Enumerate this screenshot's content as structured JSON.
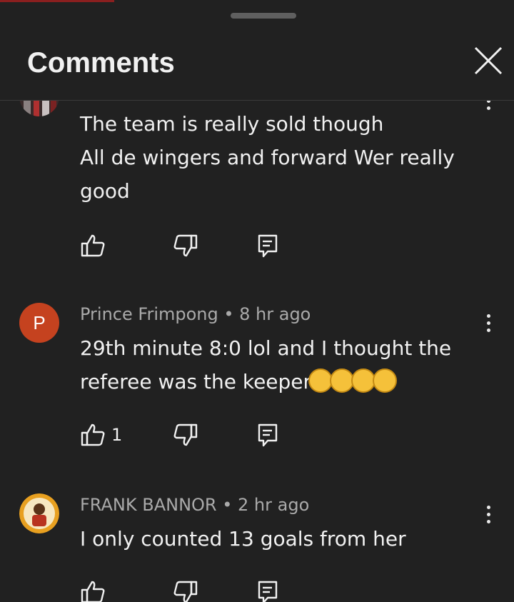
{
  "header": {
    "title": "Comments",
    "close_icon": "close-icon"
  },
  "comments": [
    {
      "author": "",
      "time": "",
      "lines": [
        "The team is really sold though",
        "All de wingers and forward Wer really",
        "good"
      ],
      "likes": "",
      "avatar": "photo"
    },
    {
      "author": "Prince Frimpong",
      "time": "8 hr ago",
      "meta": "Prince Frimpong • 8 hr ago",
      "avatar_letter": "P",
      "lines": [
        "29th minute 8:0 lol and I thought the",
        "referee was the keeper"
      ],
      "emoji": [
        "rolling-on-floor-laughing",
        "rolling-on-floor-laughing",
        "rolling-on-floor-laughing",
        "rolling-on-floor-laughing"
      ],
      "likes": "1"
    },
    {
      "author": "FRANK BANNOR",
      "time": "2 hr ago",
      "meta": "FRANK BANNOR • 2 hr ago",
      "lines": [
        "I only counted 13 goals from her"
      ],
      "likes": "",
      "avatar": "photo"
    }
  ],
  "icons": {
    "like": "thumbs-up-icon",
    "dislike": "thumbs-down-icon",
    "reply": "reply-icon",
    "menu": "more-vertical-icon"
  },
  "colors": {
    "background": "#212121",
    "avatar_p": "#c5421f",
    "meta_text": "#aaaaaa"
  }
}
